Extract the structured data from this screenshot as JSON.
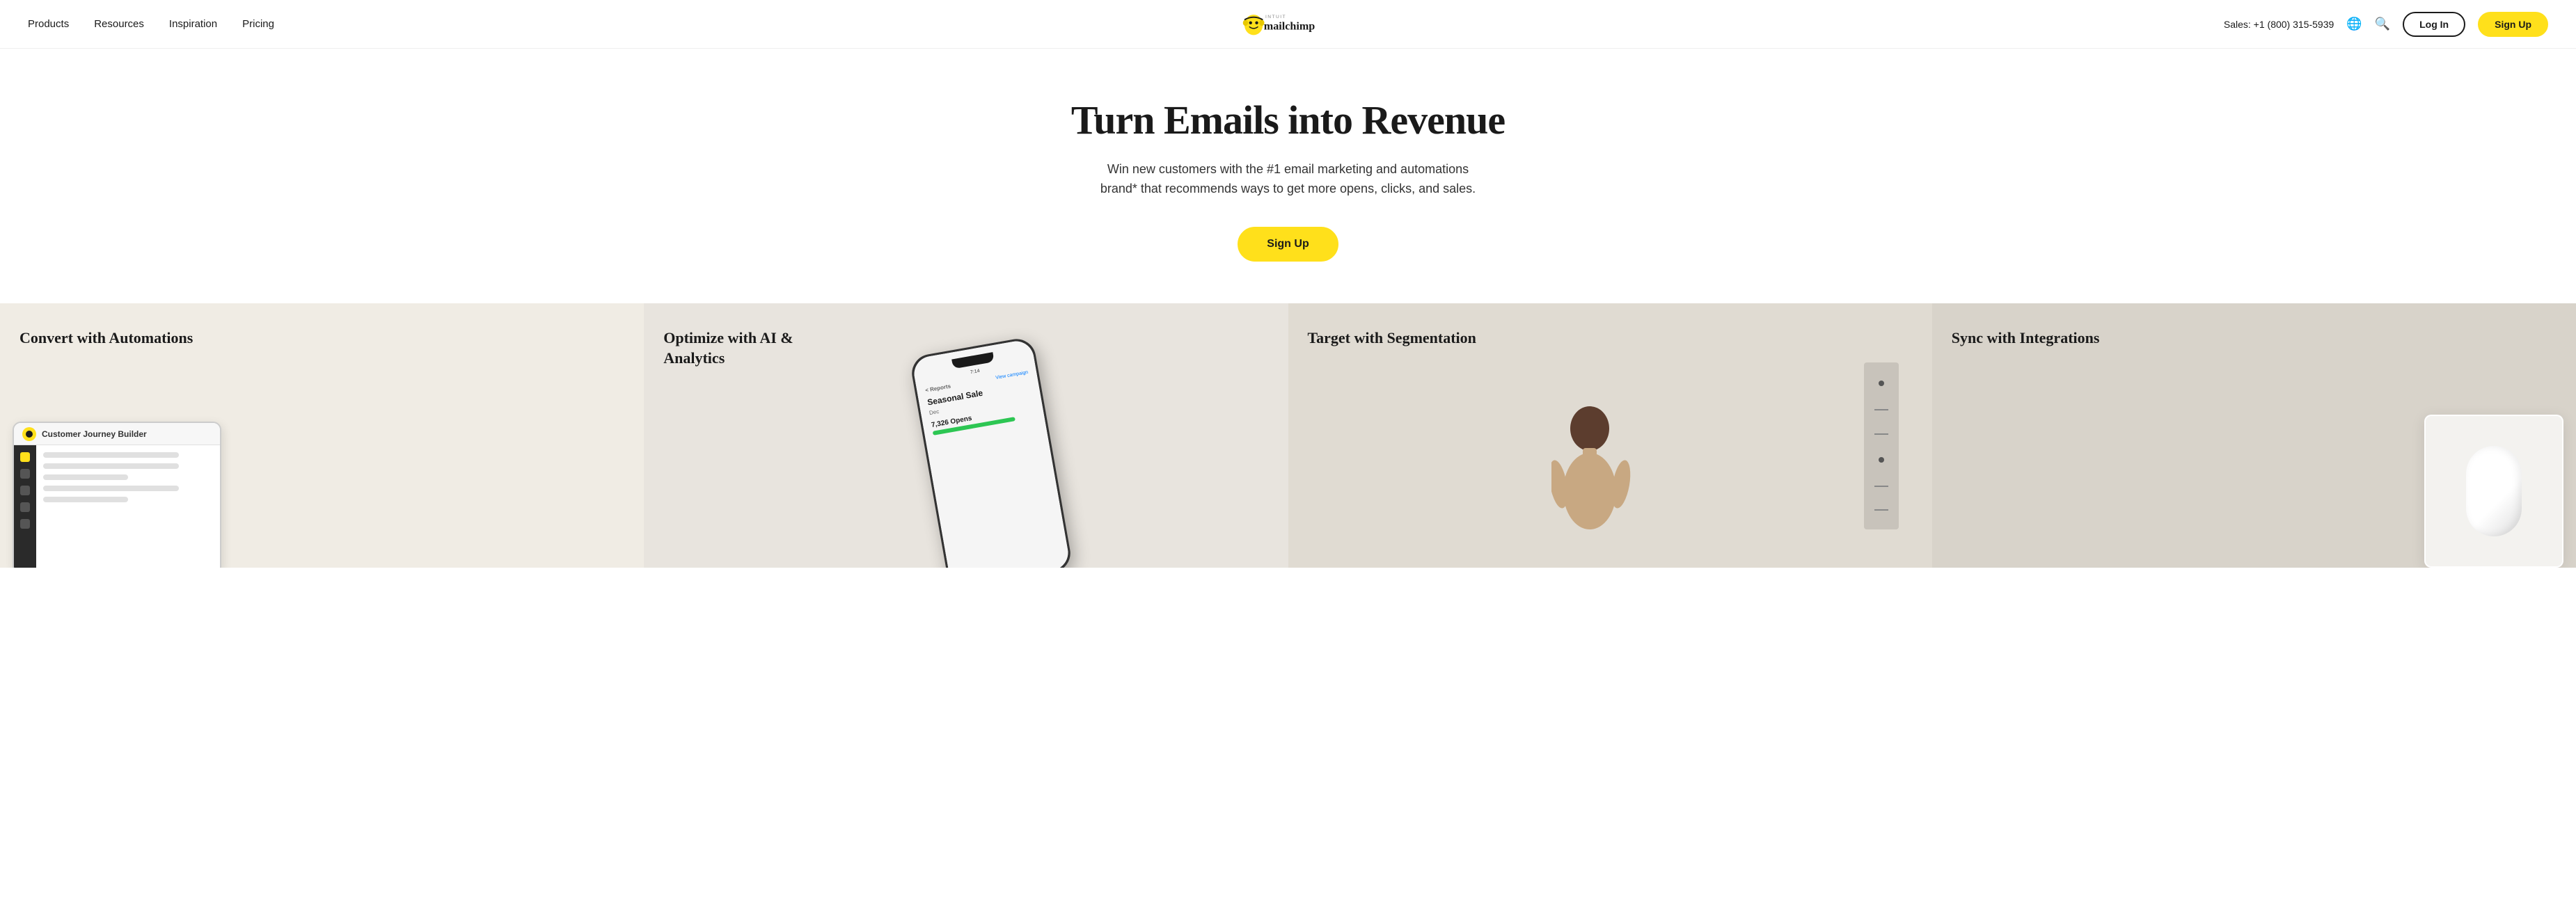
{
  "nav": {
    "items": [
      {
        "label": "Products",
        "id": "nav-products"
      },
      {
        "label": "Resources",
        "id": "nav-resources"
      },
      {
        "label": "Inspiration",
        "id": "nav-inspiration"
      },
      {
        "label": "Pricing",
        "id": "nav-pricing"
      }
    ],
    "phone": "Sales: +1 (800) 315-5939",
    "login_label": "Log In",
    "signup_label": "Sign Up"
  },
  "hero": {
    "title": "Turn Emails into Revenue",
    "subtitle": "Win new customers with the #1 email marketing and automations brand* that recommends ways to get more opens, clicks, and sales.",
    "cta_label": "Sign Up"
  },
  "features": [
    {
      "title": "Convert with Automations",
      "card_label": "Customer Journey Builder",
      "type": "automations"
    },
    {
      "title": "Optimize with AI & Analytics",
      "card_label": "Seasonal Sale",
      "stat": "7,326 Opens",
      "time": "7:14",
      "reports": "< Reports",
      "view_campaign": "View campaign",
      "type": "analytics"
    },
    {
      "title": "Target with Segmentation",
      "type": "segmentation"
    },
    {
      "title": "Sync with Integrations",
      "type": "integrations"
    }
  ],
  "icons": {
    "globe": "🌐",
    "search": "🔍"
  }
}
